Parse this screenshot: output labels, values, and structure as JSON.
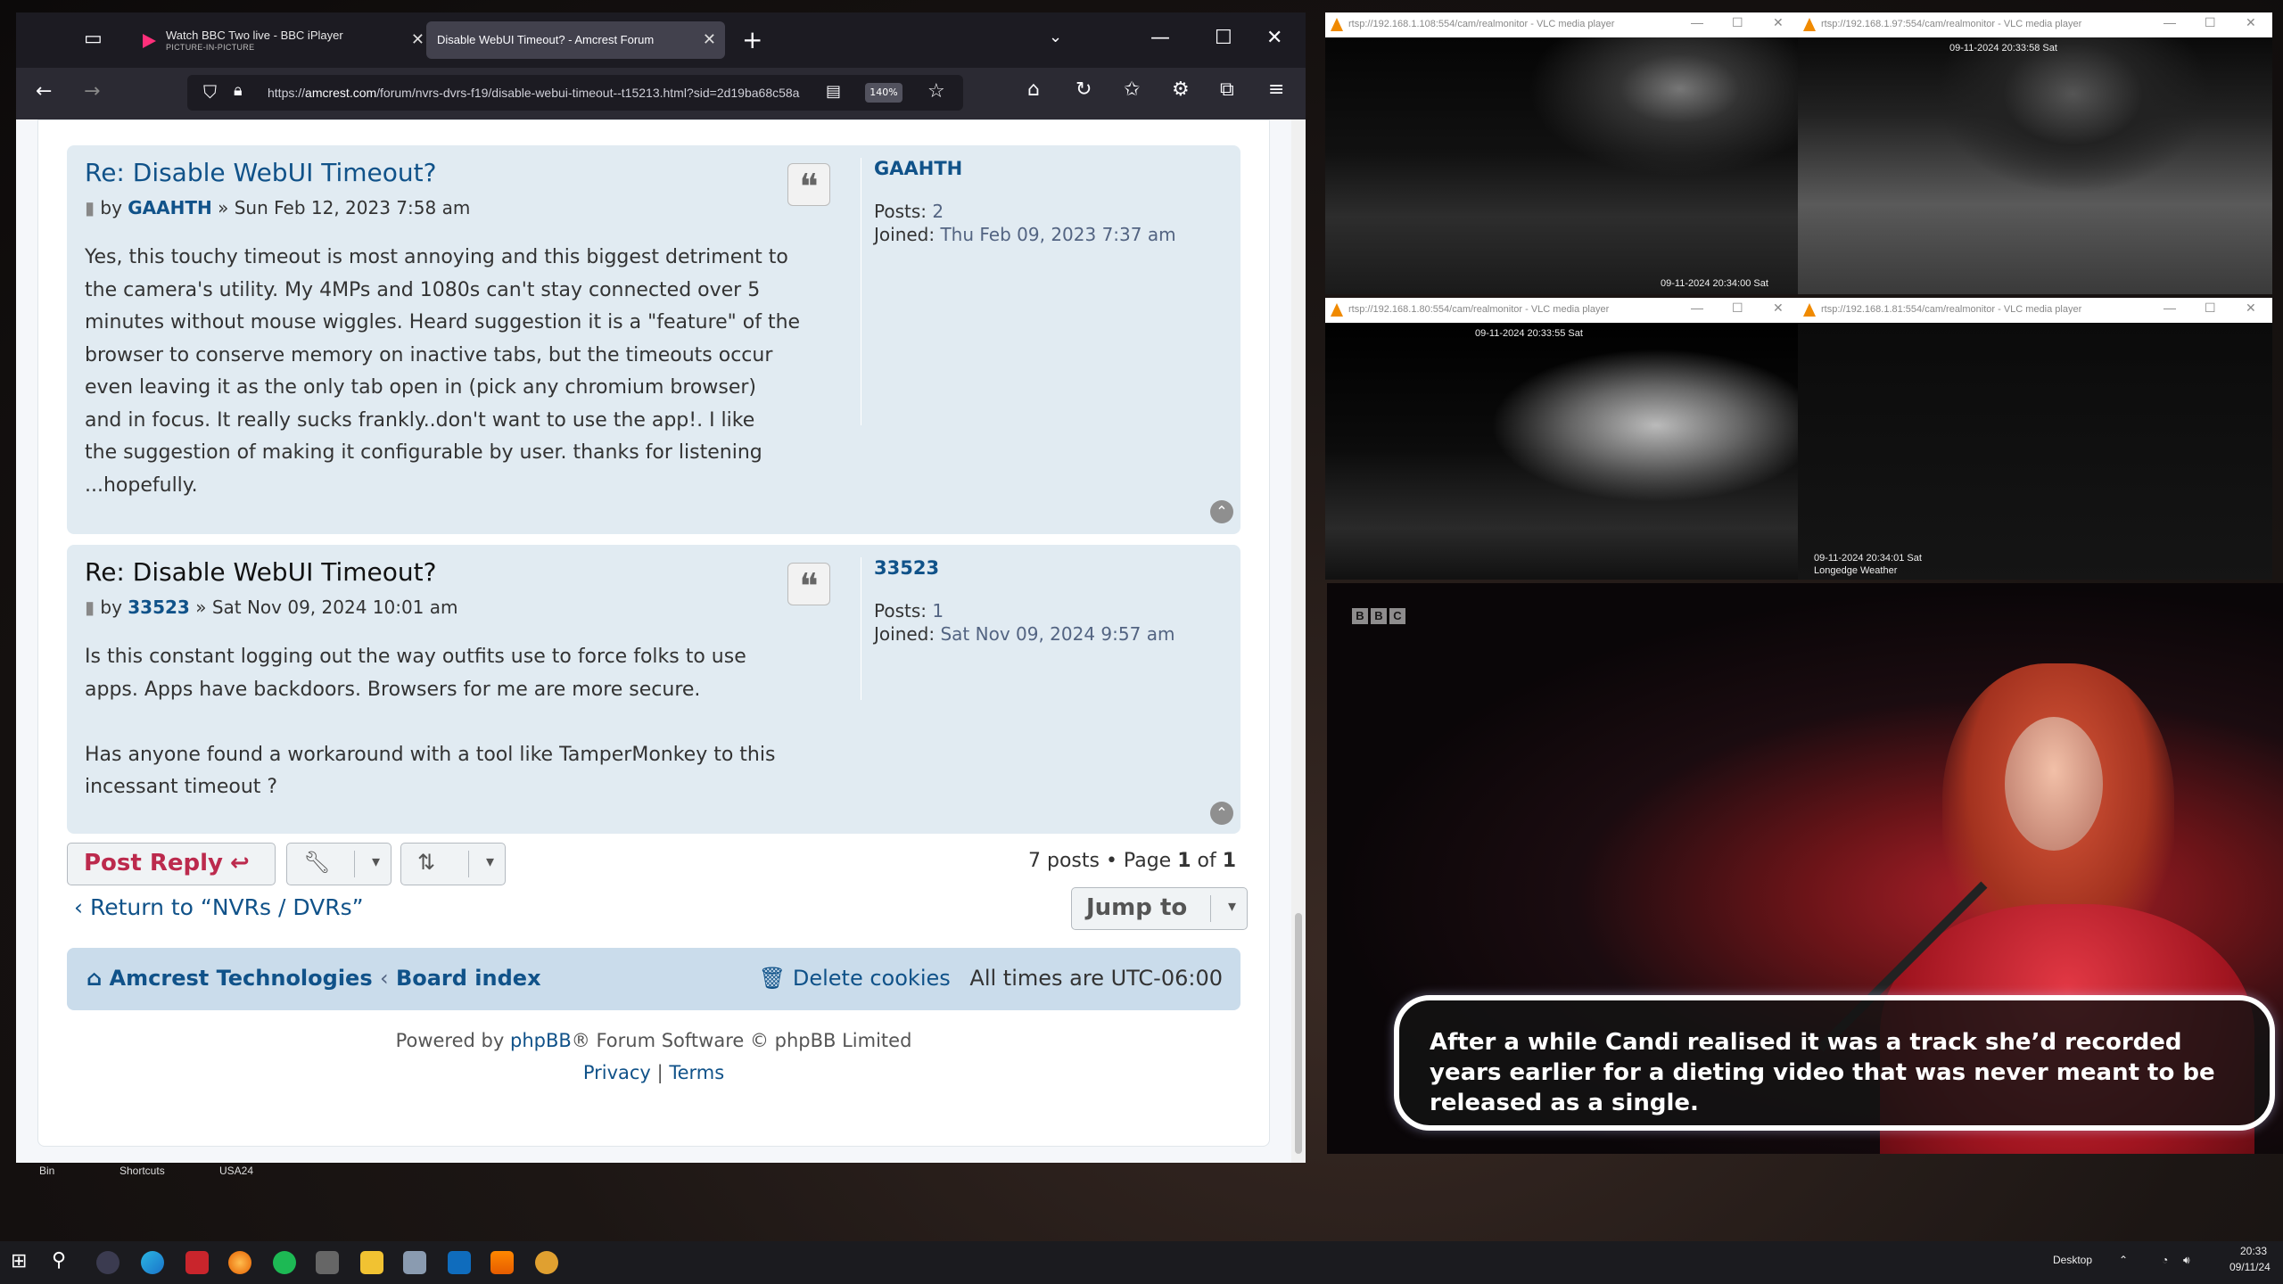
{
  "desktop": {
    "icons": [
      "Bin",
      "Shortcuts",
      "USA24"
    ]
  },
  "firefox": {
    "tabs": [
      {
        "title": "Watch BBC Two live - BBC iPlayer",
        "subtitle": "PICTURE-IN-PICTURE",
        "active": false
      },
      {
        "title": "Disable WebUI Timeout? - Amcrest Forum",
        "active": true
      }
    ],
    "url_prefix": "https://",
    "url_host": "amcrest.com",
    "url_path": "/forum/nvrs-dvrs-f19/disable-webui-timeout--t15213.html?sid=2d19ba68c58a",
    "zoom": "140%"
  },
  "forum": {
    "posts": [
      {
        "title": "Re: Disable WebUI Timeout?",
        "by": "by",
        "author": "GAAHTH",
        "date": "» Sun Feb 12, 2023 7:58 am",
        "body": [
          "Yes, this touchy timeout is most annoying and this biggest detriment to",
          "the camera's utility. My 4MPs and 1080s can't stay connected over 5",
          "minutes without mouse wiggles. Heard suggestion it is a \"feature\" of the",
          "browser to conserve memory on inactive tabs, but the timeouts occur",
          "even leaving it as the only tab open in (pick any chromium browser)",
          "and in focus. It really sucks frankly..don't want to use the app!. I like",
          "the suggestion of making it configurable by user. thanks for listening",
          "...hopefully."
        ],
        "profile": {
          "name": "GAAHTH",
          "posts_label": "Posts:",
          "posts": "2",
          "joined_label": "Joined:",
          "joined": "Thu Feb 09, 2023 7:37 am"
        }
      },
      {
        "title": "Re: Disable WebUI Timeout?",
        "by": "by",
        "author": "33523",
        "date": "» Sat Nov 09, 2024 10:01 am",
        "body": [
          "Is this constant logging out the way outfits use to force folks to use",
          "apps. Apps have backdoors. Browsers for me are more secure.",
          "",
          "Has anyone found a workaround with a tool like TamperMonkey to this",
          "incessant timeout ?"
        ],
        "profile": {
          "name": "33523",
          "posts_label": "Posts:",
          "posts": "1",
          "joined_label": "Joined:",
          "joined": "Sat Nov 09, 2024 9:57 am"
        }
      }
    ],
    "post_reply": "Post Reply",
    "pagination": {
      "count": "7 posts • Page",
      "page": "1",
      "of": "of",
      "total": "1"
    },
    "return_link": "Return to “NVRs / DVRs”",
    "jump_to": "Jump to",
    "footer": {
      "home": "Amcrest Technologies",
      "board_index": "Board index",
      "delete_cookies": "Delete cookies",
      "timezone": "All times are UTC-06:00"
    },
    "powered_pre": "Powered by",
    "powered_link": "phpBB",
    "powered_post": "® Forum Software © phpBB Limited",
    "privacy": "Privacy",
    "links_sep": "|",
    "terms": "Terms"
  },
  "vlc": [
    {
      "title": "rtsp://192.168.1.108:554/cam/realmonitor - VLC media player",
      "timestamp": "09-11-2024 20:34:00 Sat"
    },
    {
      "title": "rtsp://192.168.1.97:554/cam/realmonitor - VLC media player",
      "timestamp": "09-11-2024 20:33:58 Sat"
    },
    {
      "title": "rtsp://192.168.1.80:554/cam/realmonitor - VLC media player",
      "timestamp": "09-11-2024 20:33:55 Sat"
    },
    {
      "title": "rtsp://192.168.1.81:554/cam/realmonitor - VLC media player",
      "timestamp": "09-11-2024 20:34:01 Sat",
      "caption": "Longedge Weather"
    }
  ],
  "pip": {
    "logo": [
      "B",
      "B",
      "C"
    ],
    "subtitle": "After a while Candi realised it was a track she’d recorded years earlier for a dieting video that was never meant to be released as a single."
  },
  "taskbar": {
    "desktop_label": "Desktop",
    "time": "20:33",
    "date": "09/11/24"
  },
  "colors": {
    "link": "#105289",
    "post_bg": "#e1ebf2",
    "reply": "#bc2a4d",
    "taskbar": "#1b1b1f"
  }
}
